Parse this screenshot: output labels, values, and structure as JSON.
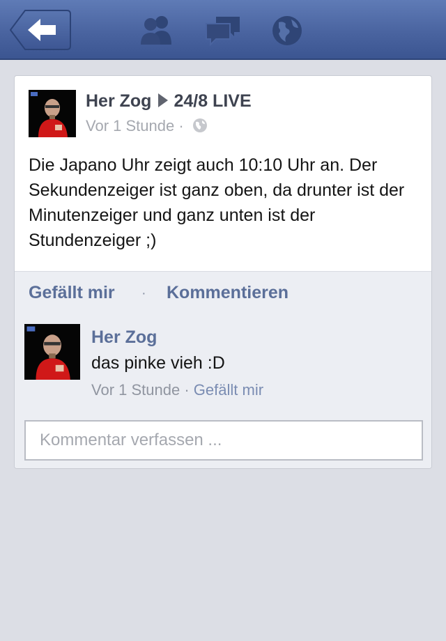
{
  "nav": {
    "back_icon": "back-arrow-icon",
    "icons": [
      "friends-icon",
      "messages-icon",
      "globe-icon"
    ]
  },
  "post": {
    "author": "Her Zog",
    "target": "24/8 LIVE",
    "time": "Vor 1 Stunde",
    "meta_separator": "·",
    "privacy_icon": "globe-icon",
    "text": "Die Japano Uhr zeigt auch 10:10 Uhr an. Der Sekundenzeiger ist ganz oben, da drunter ist der Minutenzeiger und ganz unten ist der Stundenzeiger ;)"
  },
  "actions": {
    "like": "Gefällt mir",
    "separator": "·",
    "comment": "Kommentieren"
  },
  "comment": {
    "author": "Her Zog",
    "text": "das pinke vieh :D",
    "time": "Vor 1 Stunde",
    "separator": "·",
    "like": "Gefällt mir"
  },
  "composer": {
    "placeholder": "Kommentar verfassen ..."
  },
  "colors": {
    "header": "#4a64a0",
    "link": "#5b6f99",
    "background": "#dcdee5"
  }
}
